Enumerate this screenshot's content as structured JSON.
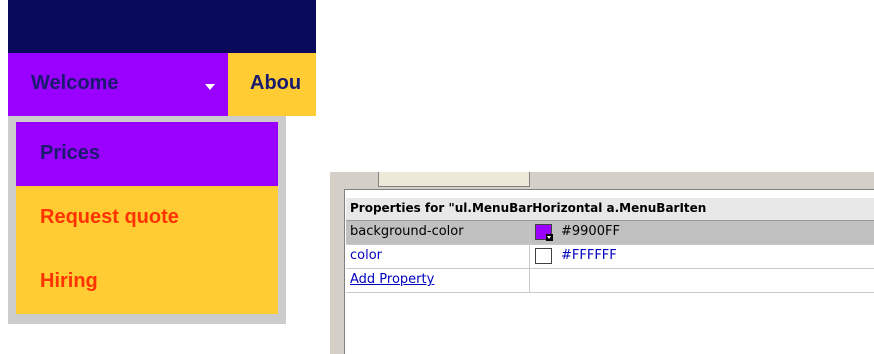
{
  "menubar": {
    "items": [
      {
        "label": "Welcome"
      },
      {
        "label": "Abou"
      }
    ]
  },
  "submenu": {
    "items": [
      {
        "label": "Prices"
      },
      {
        "label": "Request quote"
      },
      {
        "label": "Hiring"
      }
    ]
  },
  "properties_panel": {
    "header": "Properties for \"ul.MenuBarHorizontal a.MenuBarIten",
    "rows": [
      {
        "name": "background-color",
        "value": "#9900FF",
        "swatch": "#9900ff"
      },
      {
        "name": "color",
        "value": "#FFFFFF",
        "swatch": "#ffffff"
      },
      {
        "name": "Add Property",
        "value": ""
      }
    ]
  },
  "colors": {
    "menu_active": "#9900ff",
    "menu_inactive": "#ffcc33",
    "menu_text": "#1a1a6e",
    "submenu_text": "#ff3300",
    "top_strip": "#0a0a5c"
  }
}
